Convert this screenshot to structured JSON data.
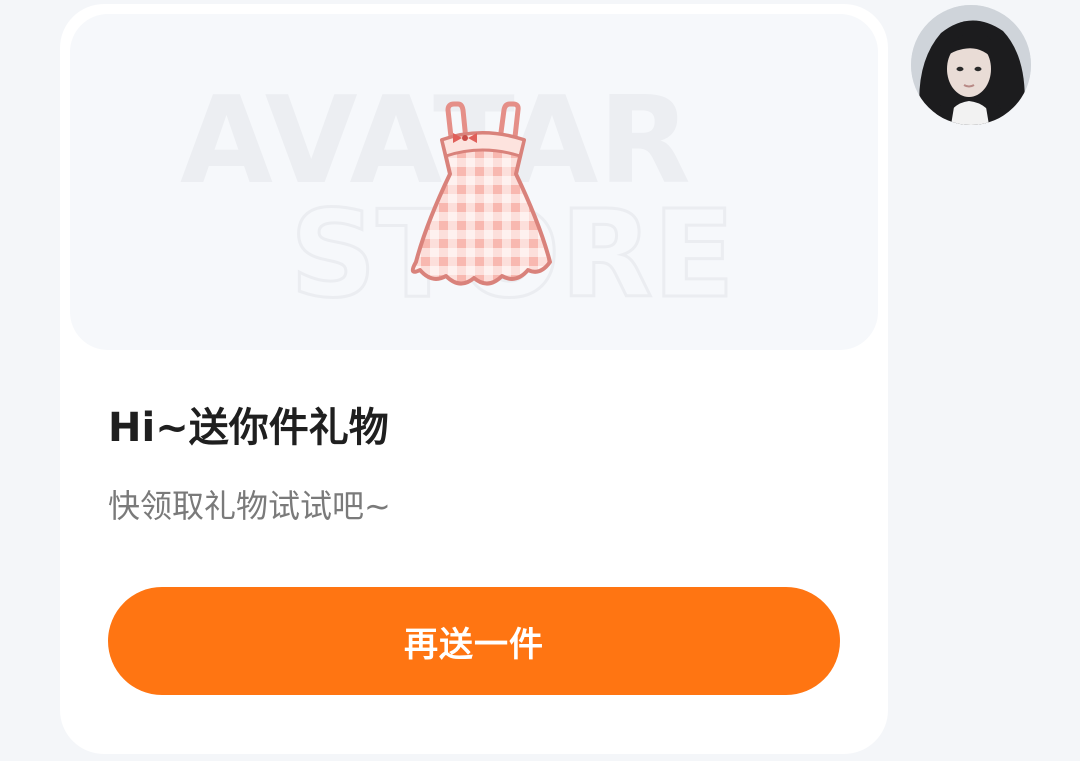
{
  "gift_card": {
    "banner": {
      "watermark_line1": "AVATAR",
      "watermark_line2": "STORE",
      "item_icon": "pink-plaid-dress-icon"
    },
    "title": "Hi~送你件礼物",
    "subtitle": "快领取礼物试试吧~",
    "send_button_label": "再送一件"
  },
  "sender": {
    "avatar_icon": "user-avatar-photo"
  },
  "colors": {
    "page_background": "#f4f6f9",
    "card_background": "#ffffff",
    "banner_background": "#f6f8fb",
    "button_color": "#ff7512",
    "title_color": "#1f1f1f",
    "subtitle_color": "#7a7a7a",
    "dress_pink": "#f4a6a0"
  }
}
